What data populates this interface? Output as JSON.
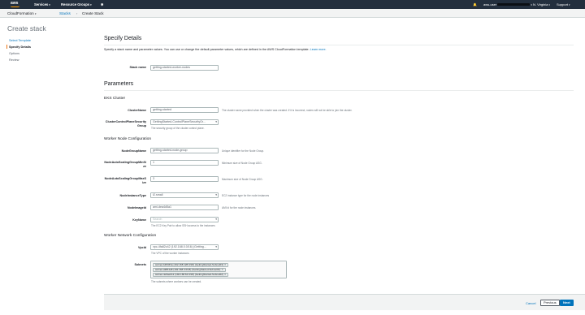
{
  "topnav": {
    "logo": "aws",
    "services": "Services",
    "resource_groups": "Resource Groups",
    "bell": "🔔",
    "account": "aws-user",
    "region": "N. Virginia",
    "support": "Support"
  },
  "breadcrumb": {
    "service": "CloudFormation",
    "stacks": "Stacks",
    "current": "Create Stack"
  },
  "page": {
    "title": "Create stack"
  },
  "steps": [
    {
      "label": "Select Template"
    },
    {
      "label": "Specify Details"
    },
    {
      "label": "Options"
    },
    {
      "label": "Review"
    }
  ],
  "specify": {
    "heading": "Specify Details",
    "description": "Specify a stack name and parameter values. You can use or change the default parameter values, which are defined in the AWS CloudFormation template.",
    "learn_more": "Learn more.",
    "stack_name_label": "Stack name",
    "stack_name_value": "getting-started-worker-nodes"
  },
  "parameters": {
    "heading": "Parameters",
    "eks_heading": "EKS Cluster",
    "cluster_name_label": "ClusterName",
    "cluster_name_value": "getting-started",
    "cluster_name_side": "The cluster name provided when the cluster was created. If it is incorrect, nodes will not be able to join the cluster.",
    "cpsg_label": "ClusterControlPlaneSecurityGroup",
    "cpsg_value": "GettingStarted-ControlPlaneSecurityGr...",
    "cpsg_hint": "The security group of the cluster control plane.",
    "worker_heading": "Worker Node Configuration",
    "ngname_label": "NodeGroupName",
    "ngname_value": "getting-started-node-group",
    "ngname_side": "Unique identifier for the Node Group.",
    "ngmin_label": "NodeAutoScalingGroupMinSize",
    "ngmin_value": "1",
    "ngmin_side": "Minimum size of Node Group ASG.",
    "ngmax_label": "NodeAutoScalingGroupMaxSize",
    "ngmax_value": "3",
    "ngmax_side": "Maximum size of Node Group ASG.",
    "itype_label": "NodeInstanceType",
    "itype_value": "t2.small",
    "itype_side": "EC2 instance type for the node instances",
    "ami_label": "NodeImageId",
    "ami_value": "ami-dea4d5a1",
    "ami_side": "AMI id for the node instances.",
    "key_label": "KeyName",
    "key_placeholder": "Search",
    "key_hint": "The EC2 Key Pair to allow SSH access to the instances",
    "network_heading": "Worker Network Configuration",
    "vpc_label": "VpcId",
    "vpc_value": "vpc-4fa82c42 (192.168.0.0/16) (Getting...",
    "vpc_hint": "The VPC of the worker instances",
    "subnets_label": "Subnets",
    "subnets": [
      "subnet-b4f63f1a (192.168.128.0/18) (GettingStarted-Subnet03)",
      "subnet-a9811a8 (192.168.0.0/18) (GettingStarted-Subnet01)",
      "subnet-4e6aeb12 (192.168.64.0/18) (GettingStarted-Subnet02)"
    ],
    "subnets_hint": "The subnets where workers can be created."
  },
  "footer": {
    "cancel": "Cancel",
    "previous": "Previous",
    "next": "Next"
  }
}
